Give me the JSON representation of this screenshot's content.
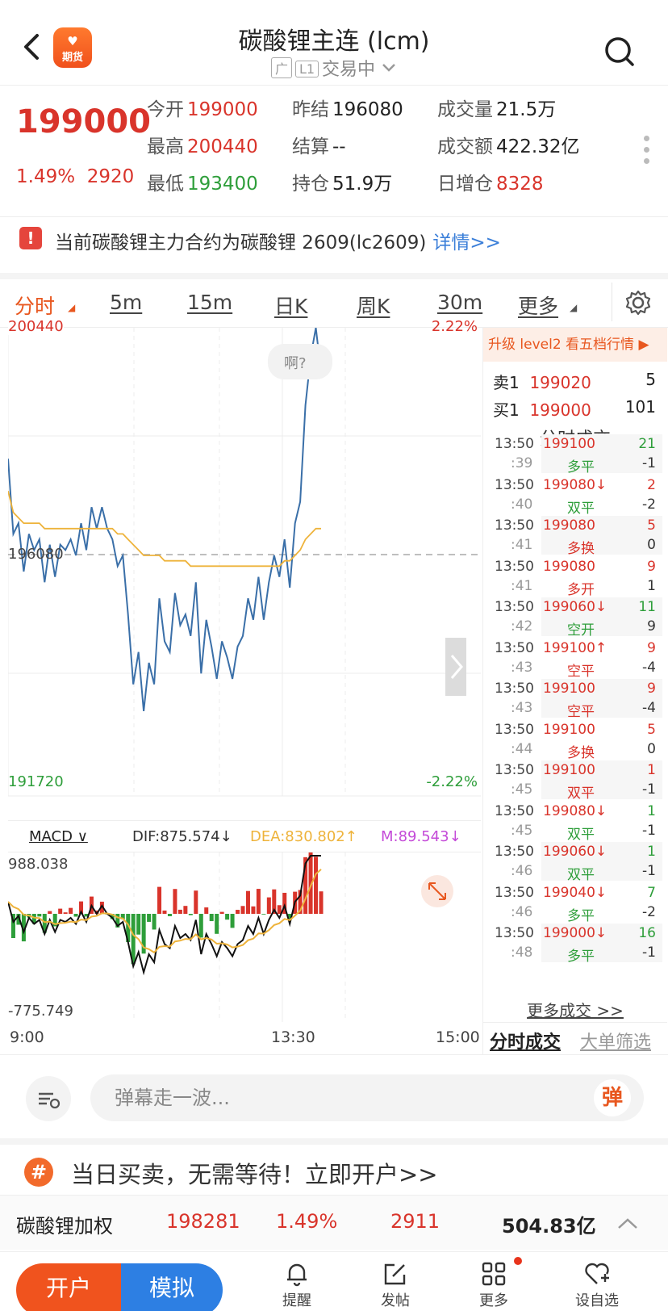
{
  "header": {
    "logo_top": "♥",
    "logo_text": "期货",
    "title": "碳酸锂主连 (lcm)",
    "tag1": "广",
    "tag2": "L1",
    "status": "交易中"
  },
  "quote": {
    "price": "199000",
    "change_pct": "1.49%",
    "change_abs": "2920",
    "fields": [
      {
        "key": "今开",
        "value": "199000",
        "color": "#d9342b"
      },
      {
        "key": "昨结",
        "value": "196080",
        "color": "#222222"
      },
      {
        "key": "成交量",
        "value": "21.5万",
        "color": "#222222"
      },
      {
        "key": "最高",
        "value": "200440",
        "color": "#d9342b"
      },
      {
        "key": "结算",
        "value": "--",
        "color": "#222222"
      },
      {
        "key": "成交额",
        "value": "422.32亿",
        "color": "#222222"
      },
      {
        "key": "最低",
        "value": "193400",
        "color": "#2e9e3a"
      },
      {
        "key": "持仓",
        "value": "51.9万",
        "color": "#222222"
      },
      {
        "key": "日增仓",
        "value": "8328",
        "color": "#d9342b"
      }
    ]
  },
  "notice": {
    "icon": "!",
    "text": "当前碳酸锂主力合约为碳酸锂 2609(lc2609)",
    "link": "详情>>"
  },
  "tabs": [
    "分时",
    "5m",
    "15m",
    "日K",
    "周K",
    "30m",
    "更多"
  ],
  "chart": {
    "high_label": "200440",
    "high_pct": "2.22%",
    "mid_label": "196080",
    "low_label": "191720",
    "low_pct": "-2.22%",
    "bubble": "啊?",
    "macd_label": "MACD",
    "dif": "DIF:875.574↓",
    "dea": "DEA:830.802↑",
    "m": "M:89.543↓",
    "macd_max": "988.038",
    "macd_min": "-775.749",
    "time_start": "9:00",
    "time_mid": "13:30",
    "time_end": "15:00"
  },
  "chart_data": {
    "type": "line",
    "ylim": [
      191720,
      200440
    ],
    "prev_settle": 196080,
    "series": [
      {
        "values": [
          198000,
          196600,
          196800,
          195900,
          196600,
          196300,
          196500,
          195700,
          196400,
          195800,
          196400,
          196300,
          196500,
          196200,
          196800,
          196300,
          197100,
          196700,
          197100,
          196700,
          196500,
          196000,
          196200,
          195100,
          193800,
          194400,
          193300,
          194200,
          193800,
          195400,
          194600,
          194400,
          195500,
          194900,
          195100,
          194700,
          195700,
          194000,
          195000,
          194500,
          193900,
          194600,
          194300,
          193900,
          194500,
          194700,
          195400,
          195000,
          195800,
          195000,
          195700,
          196200,
          195800,
          196500,
          195600,
          196800,
          197200,
          199000,
          199900,
          200440,
          199600
        ]
      },
      {
        "values": [
          197400,
          197000,
          196900,
          196800,
          196800,
          196800,
          196800,
          196700,
          196700,
          196700,
          196700,
          196700,
          196700,
          196700,
          196700,
          196700,
          196700,
          196700,
          196700,
          196700,
          196700,
          196600,
          196600,
          196500,
          196400,
          196300,
          196200,
          196200,
          196200,
          196200,
          196100,
          196100,
          196100,
          196100,
          196100,
          196000,
          196000,
          196000,
          196000,
          196000,
          196000,
          196000,
          196000,
          196000,
          196000,
          196000,
          196000,
          196000,
          196000,
          196000,
          196000,
          196000,
          196000,
          196100,
          196100,
          196200,
          196300,
          196500,
          196600,
          196700,
          196700
        ]
      }
    ]
  },
  "right_panel": {
    "upgrade": "升级 level2 看五档行情 ▶",
    "sell_label": "卖1",
    "sell_price": "199020",
    "sell_vol": "5",
    "buy_label": "买1",
    "buy_price": "199000",
    "buy_vol": "101",
    "trades_title": "分时成交",
    "trades": [
      {
        "t1": "13:50",
        "t2": ":39",
        "p": "199100",
        "a": "多平",
        "v1": "21",
        "v2": "-1",
        "pc": "#d9342b",
        "ac": "#2e9e3a",
        "vc": "#2e9e3a"
      },
      {
        "t1": "13:50",
        "t2": ":40",
        "p": "199080↓",
        "a": "双平",
        "v1": "2",
        "v2": "-2",
        "pc": "#d9342b",
        "ac": "#2e9e3a",
        "vc": "#d9342b"
      },
      {
        "t1": "13:50",
        "t2": ":41",
        "p": "199080",
        "a": "多换",
        "v1": "5",
        "v2": "0",
        "pc": "#d9342b",
        "ac": "#d9342b",
        "vc": "#d9342b"
      },
      {
        "t1": "13:50",
        "t2": ":41",
        "p": "199080",
        "a": "多开",
        "v1": "9",
        "v2": "1",
        "pc": "#d9342b",
        "ac": "#d9342b",
        "vc": "#d9342b"
      },
      {
        "t1": "13:50",
        "t2": ":42",
        "p": "199060↓",
        "a": "空开",
        "v1": "11",
        "v2": "9",
        "pc": "#d9342b",
        "ac": "#2e9e3a",
        "vc": "#2e9e3a"
      },
      {
        "t1": "13:50",
        "t2": ":43",
        "p": "199100↑",
        "a": "空平",
        "v1": "9",
        "v2": "-4",
        "pc": "#d9342b",
        "ac": "#d9342b",
        "vc": "#d9342b"
      },
      {
        "t1": "13:50",
        "t2": ":43",
        "p": "199100",
        "a": "空平",
        "v1": "9",
        "v2": "-4",
        "pc": "#d9342b",
        "ac": "#d9342b",
        "vc": "#d9342b"
      },
      {
        "t1": "13:50",
        "t2": ":44",
        "p": "199100",
        "a": "多换",
        "v1": "5",
        "v2": "0",
        "pc": "#d9342b",
        "ac": "#d9342b",
        "vc": "#d9342b"
      },
      {
        "t1": "13:50",
        "t2": ":45",
        "p": "199100",
        "a": "双平",
        "v1": "1",
        "v2": "-1",
        "pc": "#d9342b",
        "ac": "#d9342b",
        "vc": "#d9342b"
      },
      {
        "t1": "13:50",
        "t2": ":45",
        "p": "199080↓",
        "a": "双平",
        "v1": "1",
        "v2": "-1",
        "pc": "#d9342b",
        "ac": "#2e9e3a",
        "vc": "#2e9e3a"
      },
      {
        "t1": "13:50",
        "t2": ":46",
        "p": "199060↓",
        "a": "双平",
        "v1": "1",
        "v2": "-1",
        "pc": "#d9342b",
        "ac": "#2e9e3a",
        "vc": "#2e9e3a"
      },
      {
        "t1": "13:50",
        "t2": ":46",
        "p": "199040↓",
        "a": "多平",
        "v1": "7",
        "v2": "-2",
        "pc": "#d9342b",
        "ac": "#2e9e3a",
        "vc": "#2e9e3a"
      },
      {
        "t1": "13:50",
        "t2": ":48",
        "p": "199000↓",
        "a": "多平",
        "v1": "16",
        "v2": "-1",
        "pc": "#d9342b",
        "ac": "#2e9e3a",
        "vc": "#2e9e3a"
      }
    ],
    "more": "更多成交 >>",
    "tab1": "分时成交",
    "tab2": "大单筛选"
  },
  "danmu": {
    "placeholder": "弹幕走一波...",
    "button": "弹"
  },
  "promo": {
    "icon": "#",
    "text": "当日买卖，无需等待！立即开户>>"
  },
  "weighted": {
    "name": "碳酸锂加权",
    "price": "198281",
    "pct": "1.49%",
    "chg": "2911",
    "amount": "504.83亿"
  },
  "bottom": {
    "open": "开户",
    "sim": "模拟",
    "nav": [
      {
        "label": "提醒",
        "icon": "bell-icon"
      },
      {
        "label": "发帖",
        "icon": "edit-icon"
      },
      {
        "label": "更多",
        "icon": "grid-icon"
      },
      {
        "label": "设自选",
        "icon": "heart-add-icon"
      }
    ]
  },
  "colors": {
    "up": "#d9342b",
    "down": "#2e9e3a",
    "accent": "#e8571f",
    "price_line": "#3a6fa8",
    "avg_line": "#eeb33b"
  }
}
